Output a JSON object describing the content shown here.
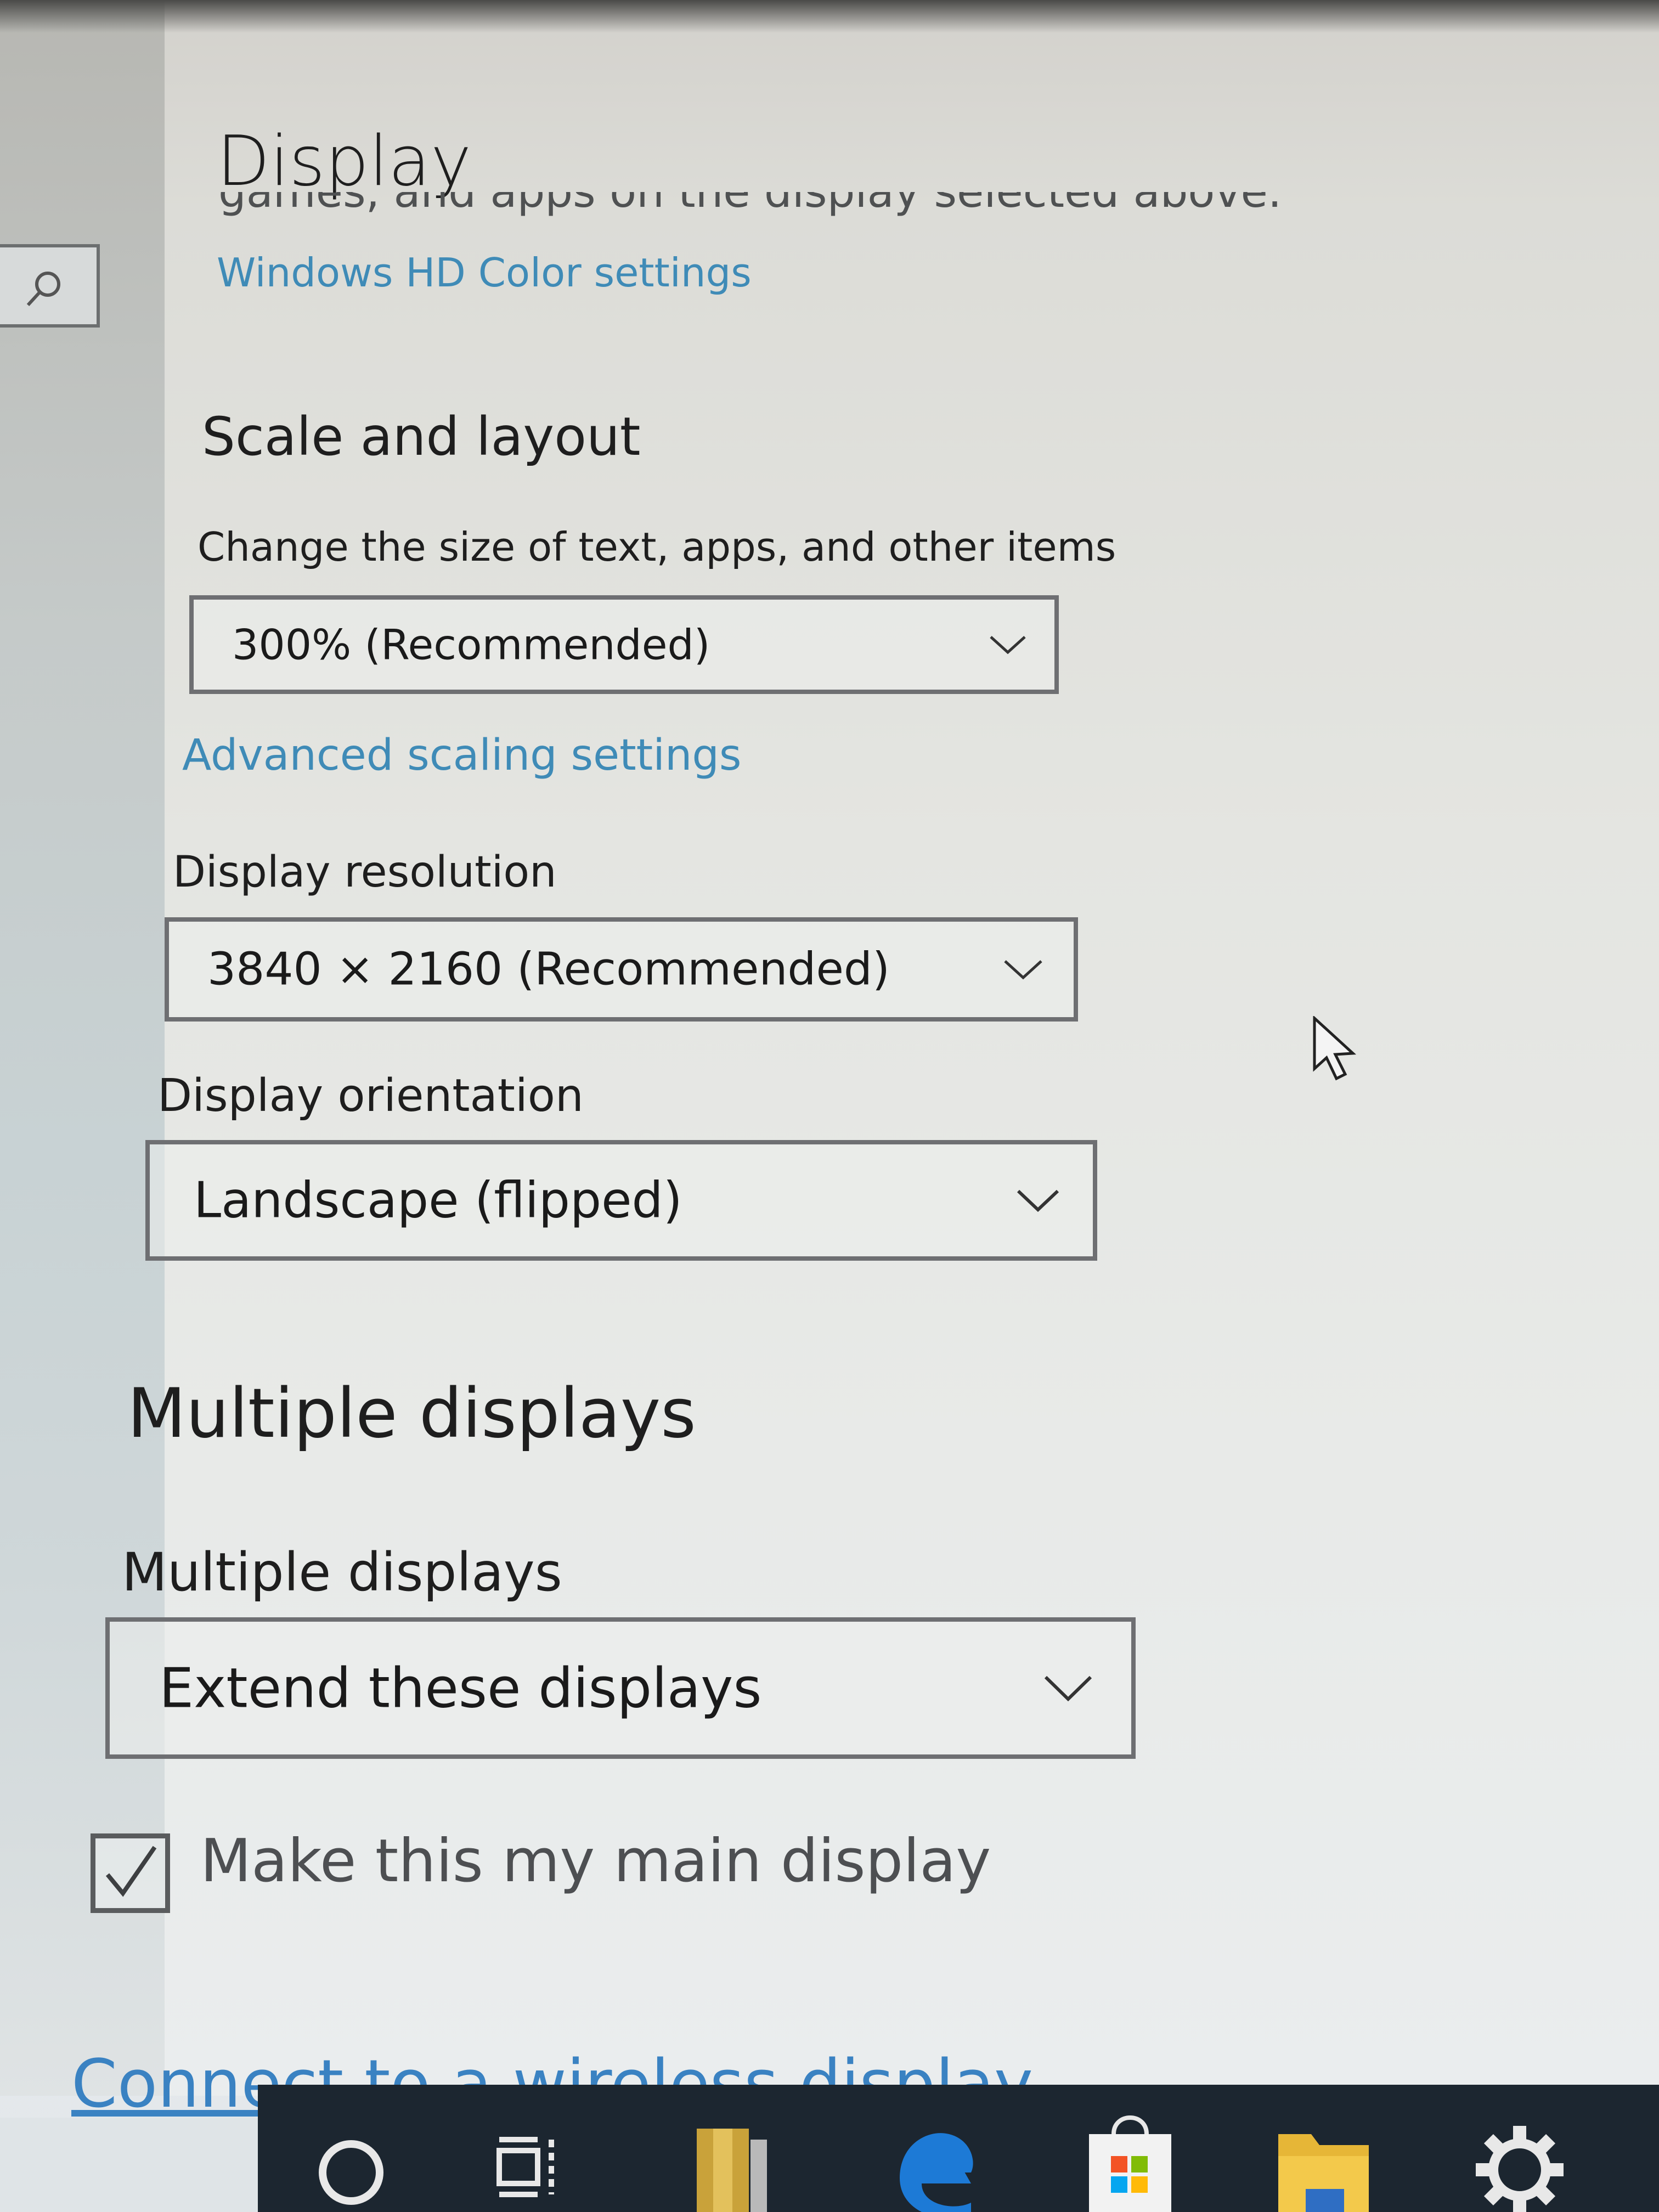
{
  "page": {
    "title": "Display",
    "clipped_text": "games, and apps on the display selected above.",
    "hd_color_link": "Windows HD Color settings"
  },
  "scale_layout": {
    "heading": "Scale and layout",
    "size_label": "Change the size of text, apps, and other items",
    "size_value": "300% (Recommended)",
    "advanced_link": "Advanced scaling settings",
    "resolution_label": "Display resolution",
    "resolution_value": "3840 × 2160 (Recommended)",
    "orientation_label": "Display orientation",
    "orientation_value": "Landscape (flipped)"
  },
  "multiple_displays": {
    "heading": "Multiple displays",
    "label": "Multiple displays",
    "value": "Extend these displays",
    "main_display_label": "Make this my main display",
    "main_display_checked": true,
    "wireless_link": "Connect to a wireless display"
  },
  "taskbar": {
    "icons": [
      "cortana-search-icon",
      "task-view-icon",
      "archive-app-icon",
      "edge-browser-icon",
      "store-icon",
      "file-explorer-icon",
      "settings-gear-icon"
    ]
  },
  "colors": {
    "link": "#3f8bb7",
    "text": "#1e1e1e",
    "taskbar": "#1c2630"
  }
}
